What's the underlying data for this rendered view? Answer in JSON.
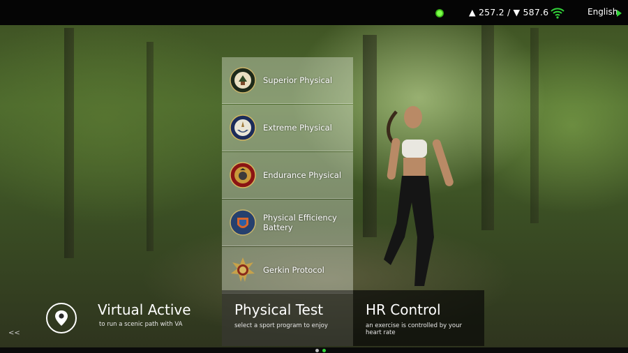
{
  "status_bar": {
    "sensor_icon": "sensor-active-icon",
    "speed_up_down": "▲ 257.2 / ▼ 587.6",
    "wifi_icon": "wifi-icon",
    "language": "English"
  },
  "menu": {
    "items": [
      {
        "label": "Superior Physical",
        "icon": "army-seal-icon"
      },
      {
        "label": "Extreme Physical",
        "icon": "navy-seal-icon"
      },
      {
        "label": "Endurance Physical",
        "icon": "marine-corps-seal-icon"
      },
      {
        "label": "Physical Efficiency Battery",
        "icon": "federal-badge-icon"
      },
      {
        "label": "Gerkin Protocol",
        "icon": "firefighter-badge-icon"
      }
    ]
  },
  "modes": {
    "virtual_active": {
      "title": "Virtual Active",
      "subtitle": "to run a scenic path with VA",
      "icon": "location-pin-icon"
    },
    "physical_test": {
      "title": "Physical Test",
      "subtitle": "select a sport program to enjoy"
    },
    "hr_control": {
      "title": "HR Control",
      "subtitle": "an exercise is controlled by your heart rate"
    }
  },
  "nav": {
    "previous": "<<"
  },
  "pager": {
    "pages": 2,
    "current": 2
  },
  "colors": {
    "accent": "#33d33a",
    "topbar": "#050505"
  }
}
